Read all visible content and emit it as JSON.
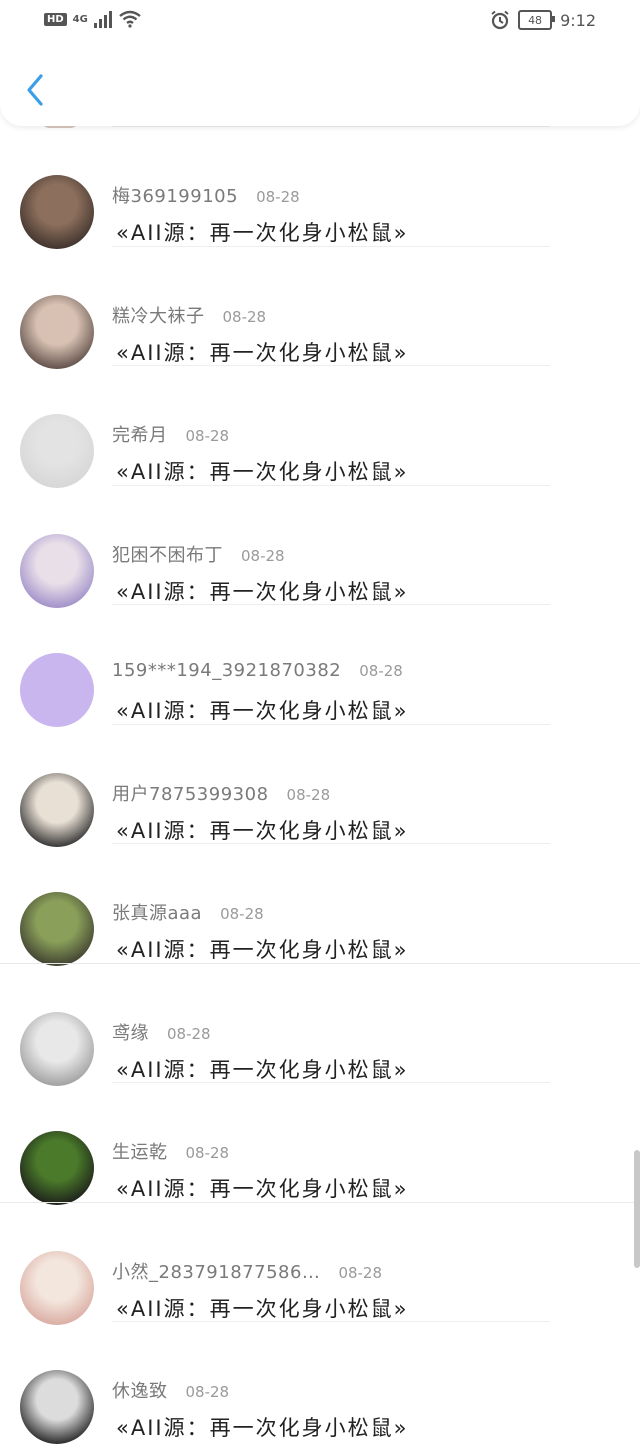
{
  "status_bar": {
    "hd": "HD",
    "network": "4G",
    "battery": "48",
    "time": "9:12"
  },
  "header": {
    "back_icon": "chevron-left-icon",
    "accent": "#3a9ee8"
  },
  "items": [
    {
      "name": "梅369199105",
      "date": "08-28",
      "message": "«AII源：再一次化身小松鼠»",
      "avatar_colors": [
        "#3b2f2a",
        "#8c6f5c"
      ]
    },
    {
      "name": "糕冷大袜子",
      "date": "08-28",
      "message": "«AII源：再一次化身小松鼠»",
      "avatar_colors": [
        "#5a4a44",
        "#d8c1b3"
      ]
    },
    {
      "name": "完希月",
      "date": "08-28",
      "message": "«AII源：再一次化身小松鼠»",
      "avatar_colors": [
        "#d6d6d6",
        "#e3e3e3"
      ]
    },
    {
      "name": "犯困不困布丁",
      "date": "08-28",
      "message": "«AII源：再一次化身小松鼠»",
      "avatar_colors": [
        "#9c8cc8",
        "#e8dfe8"
      ]
    },
    {
      "name": "159***194_3921870382",
      "date": "08-28",
      "message": "«AII源：再一次化身小松鼠»",
      "avatar_colors": [
        "#c9b6ef",
        "#c9b6ef"
      ]
    },
    {
      "name": "用户7875399308",
      "date": "08-28",
      "message": "«AII源：再一次化身小松鼠»",
      "avatar_colors": [
        "#2b2b2b",
        "#e9e0d5"
      ]
    },
    {
      "name": "张真源aaa",
      "date": "08-28",
      "message": "«AII源：再一次化身小松鼠»",
      "avatar_colors": [
        "#3b3a2e",
        "#8aa05a"
      ]
    },
    {
      "name": "鸢缘",
      "date": "08-28",
      "message": "«AII源：再一次化身小松鼠»",
      "avatar_colors": [
        "#9c9c9c",
        "#e8e8e8"
      ]
    },
    {
      "name": "生运乾",
      "date": "08-28",
      "message": "«AII源：再一次化身小松鼠»",
      "avatar_colors": [
        "#1a1a1a",
        "#4a7a2a"
      ]
    },
    {
      "name": "小然_283791877586…",
      "date": "08-28",
      "message": "«AII源：再一次化身小松鼠»",
      "avatar_colors": [
        "#d9a9a0",
        "#f3e6dd"
      ]
    },
    {
      "name": "休逸致",
      "date": "08-28",
      "message": "«AII源：再一次化身小松鼠»",
      "avatar_colors": [
        "#1e1e1e",
        "#dcdcdc"
      ]
    }
  ]
}
